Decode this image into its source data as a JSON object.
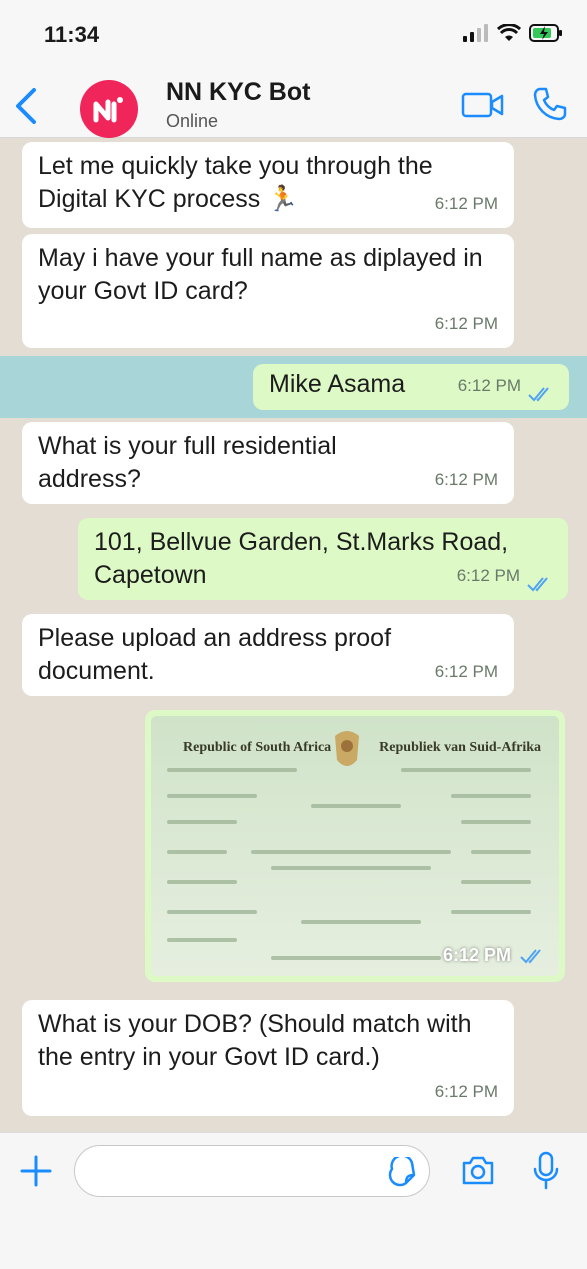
{
  "status_bar": {
    "time": "11:34"
  },
  "header": {
    "contact_name": "NN KYC Bot",
    "contact_status": "Online"
  },
  "colors": {
    "accent": "#1a8cff",
    "incoming_bubble": "#ffffff",
    "outgoing_bubble": "#ddf9c6",
    "avatar": "#f0255a",
    "chat_bg": "#e4ddd4"
  },
  "messages": [
    {
      "direction": "in",
      "text": "Let me quickly take you through the Digital KYC process 🏃",
      "time": "6:12 PM"
    },
    {
      "direction": "in",
      "text": "May i have your full name as diplayed in your Govt ID card?",
      "time": "6:12 PM"
    },
    {
      "direction": "out",
      "text": "Mike Asama",
      "time": "6:12 PM"
    },
    {
      "direction": "in",
      "text": "What is your full residential address?",
      "time": "6:12 PM"
    },
    {
      "direction": "out",
      "text": "101, Bellvue Garden, St.Marks Road, Capetown",
      "time": "6:12 PM"
    },
    {
      "direction": "in",
      "text": "Please upload an address proof document.",
      "time": "6:12 PM"
    },
    {
      "direction": "out",
      "type": "image",
      "doc_title_left": "Republic of South Africa",
      "doc_title_right": "Republiek van Suid-Afrika",
      "time": "6:12 PM"
    },
    {
      "direction": "in",
      "text": "What is your DOB? (Should match with the entry in your Govt ID card.)",
      "time": "6:12 PM"
    }
  ],
  "input_bar": {
    "placeholder": ""
  }
}
